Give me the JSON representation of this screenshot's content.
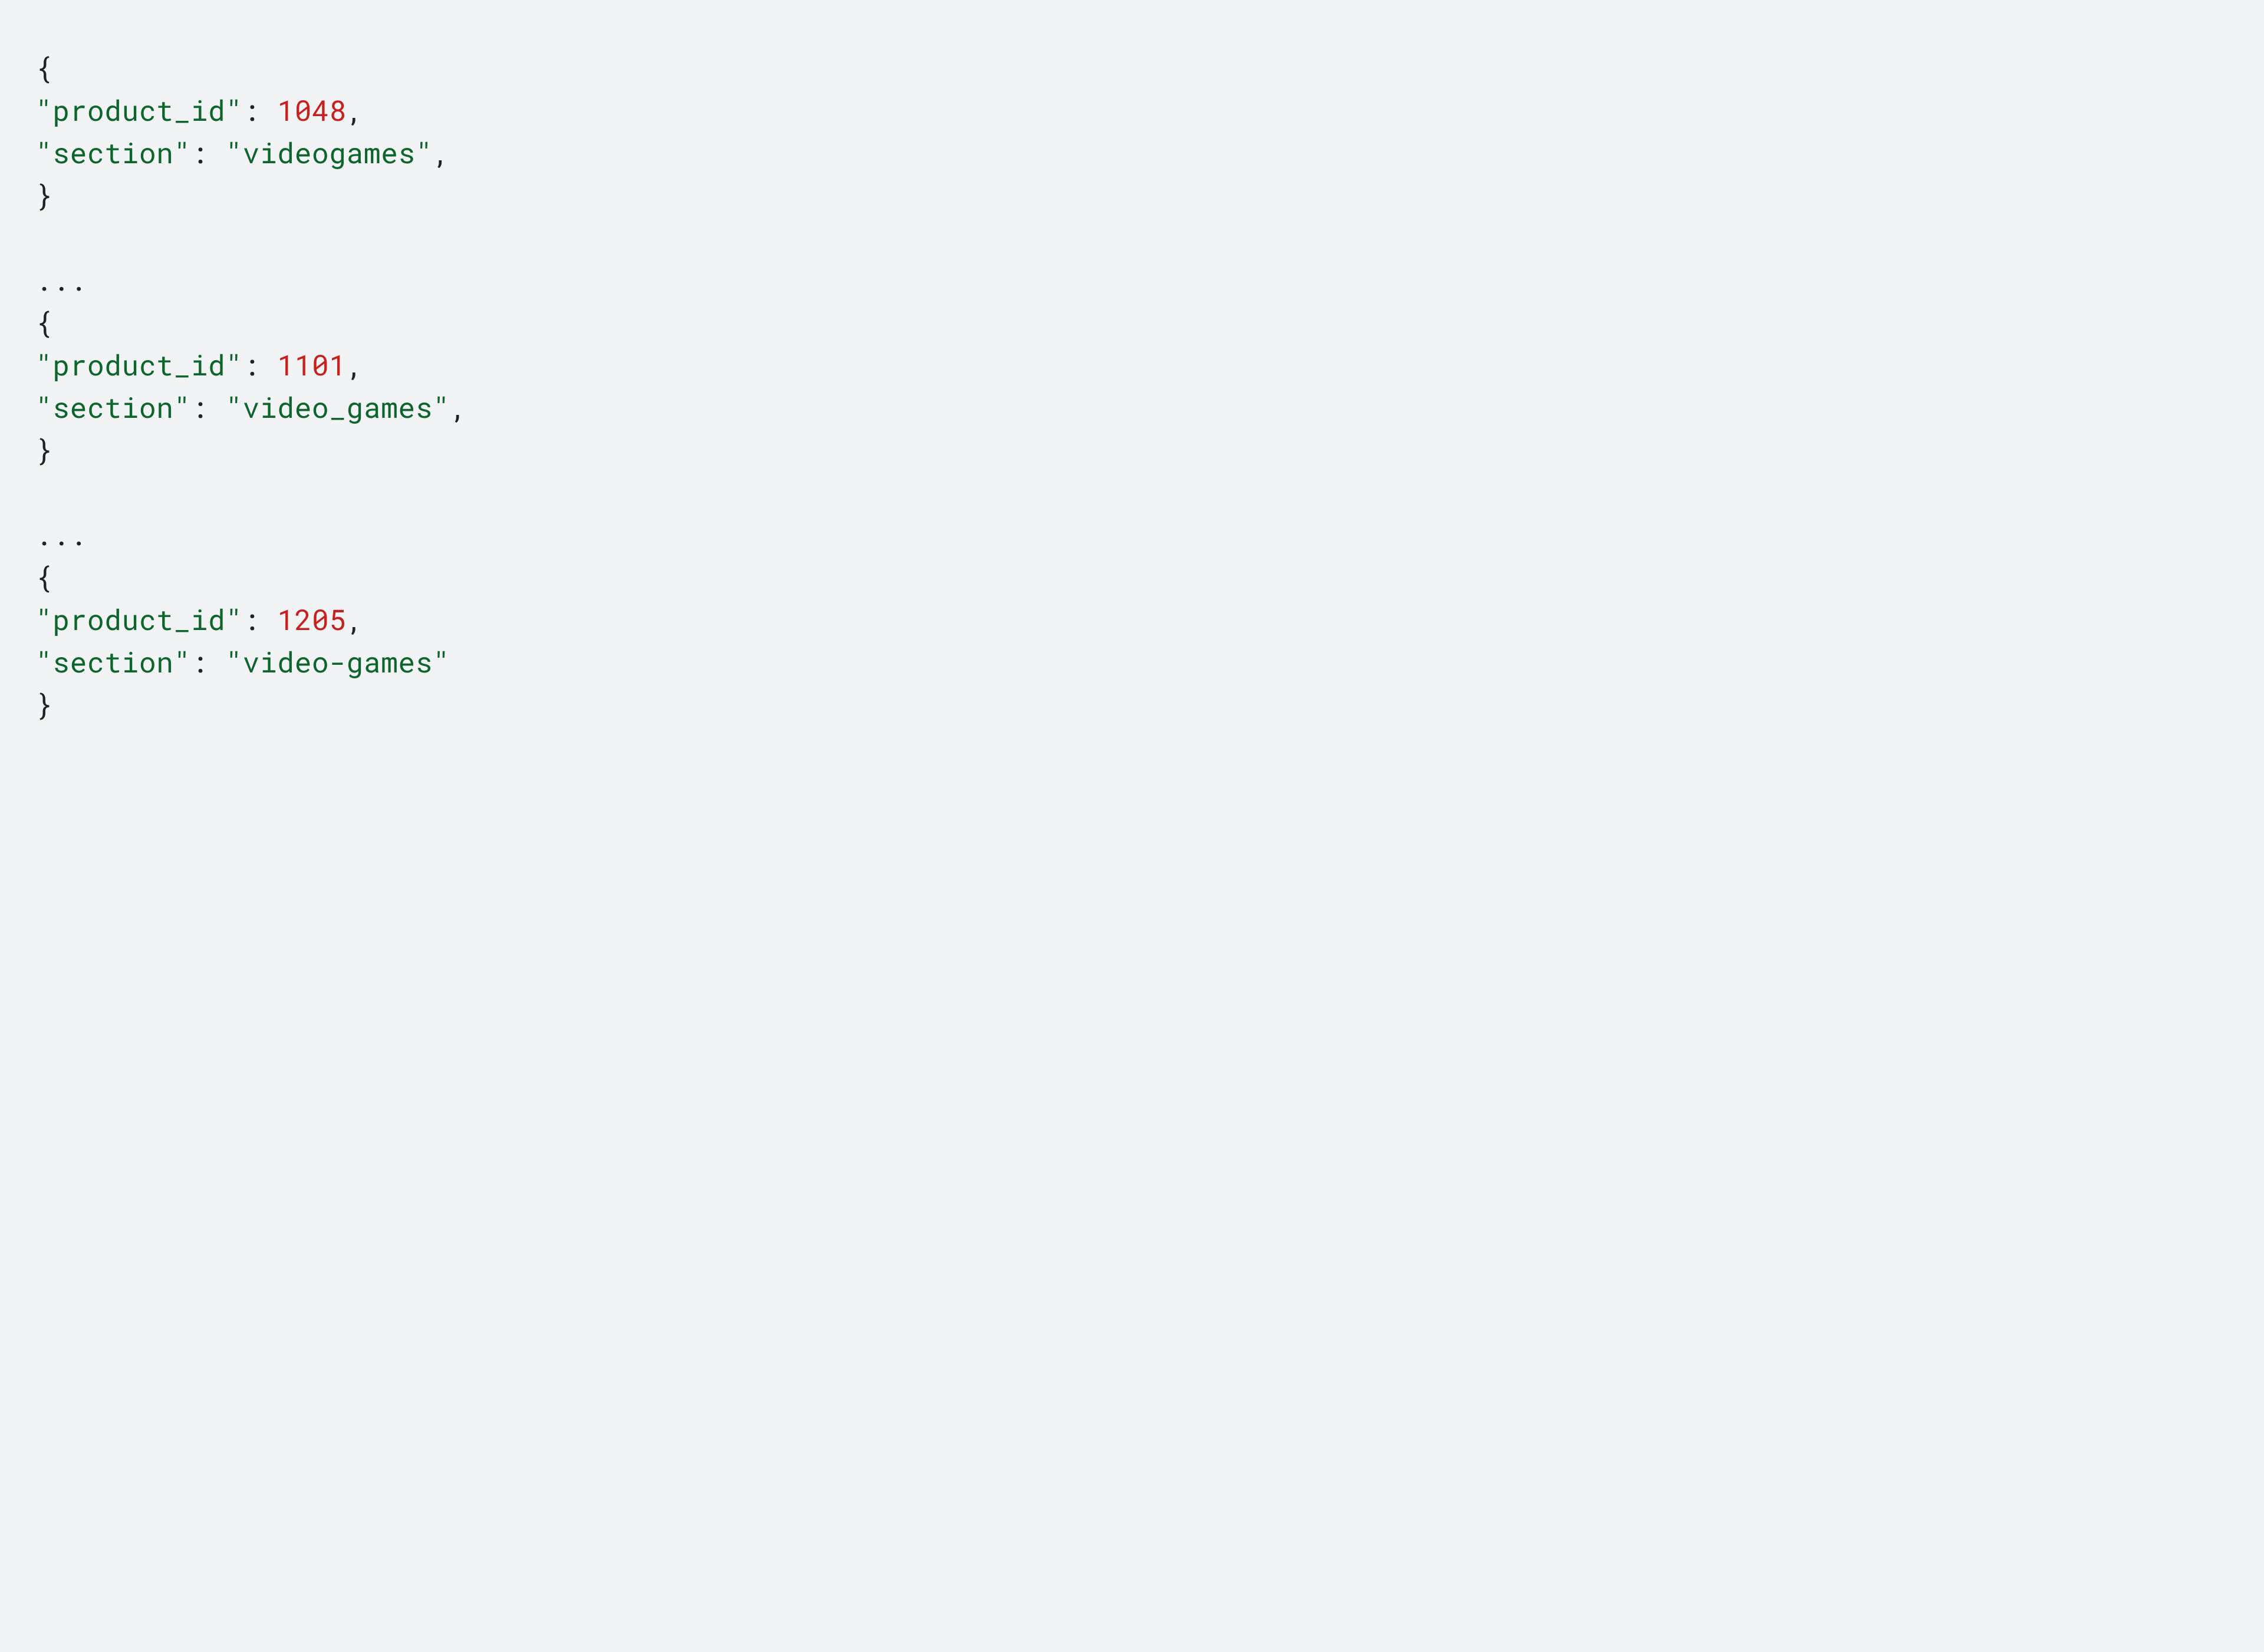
{
  "tokens": [
    {
      "t": "{",
      "cls": "punct",
      "br": true
    },
    {
      "t": "\"product_id\"",
      "cls": "str"
    },
    {
      "t": ": ",
      "cls": "punct"
    },
    {
      "t": "1048",
      "cls": "num"
    },
    {
      "t": ",",
      "cls": "punct",
      "br": true
    },
    {
      "t": "\"section\"",
      "cls": "str"
    },
    {
      "t": ": ",
      "cls": "punct"
    },
    {
      "t": "\"videogames\"",
      "cls": "str"
    },
    {
      "t": ",",
      "cls": "punct",
      "br": true
    },
    {
      "t": "}",
      "cls": "punct",
      "br": true
    },
    {
      "t": "",
      "cls": "punct",
      "br": true
    },
    {
      "t": "...",
      "cls": "punct",
      "br": true
    },
    {
      "t": "{",
      "cls": "punct",
      "br": true
    },
    {
      "t": "\"product_id\"",
      "cls": "str"
    },
    {
      "t": ": ",
      "cls": "punct"
    },
    {
      "t": "1101",
      "cls": "num"
    },
    {
      "t": ",",
      "cls": "punct",
      "br": true
    },
    {
      "t": "\"section\"",
      "cls": "str"
    },
    {
      "t": ": ",
      "cls": "punct"
    },
    {
      "t": "\"video_games\"",
      "cls": "str"
    },
    {
      "t": ",",
      "cls": "punct",
      "br": true
    },
    {
      "t": "}",
      "cls": "punct",
      "br": true
    },
    {
      "t": "",
      "cls": "punct",
      "br": true
    },
    {
      "t": "...",
      "cls": "punct",
      "br": true
    },
    {
      "t": "{",
      "cls": "punct",
      "br": true
    },
    {
      "t": "\"product_id\"",
      "cls": "str"
    },
    {
      "t": ": ",
      "cls": "punct"
    },
    {
      "t": "1205",
      "cls": "num"
    },
    {
      "t": ",",
      "cls": "punct",
      "br": true
    },
    {
      "t": "\"section\"",
      "cls": "str"
    },
    {
      "t": ": ",
      "cls": "punct"
    },
    {
      "t": "\"video-games\"",
      "cls": "str"
    },
    {
      "t": "",
      "cls": "punct",
      "br": true
    },
    {
      "t": "}",
      "cls": "punct"
    }
  ]
}
